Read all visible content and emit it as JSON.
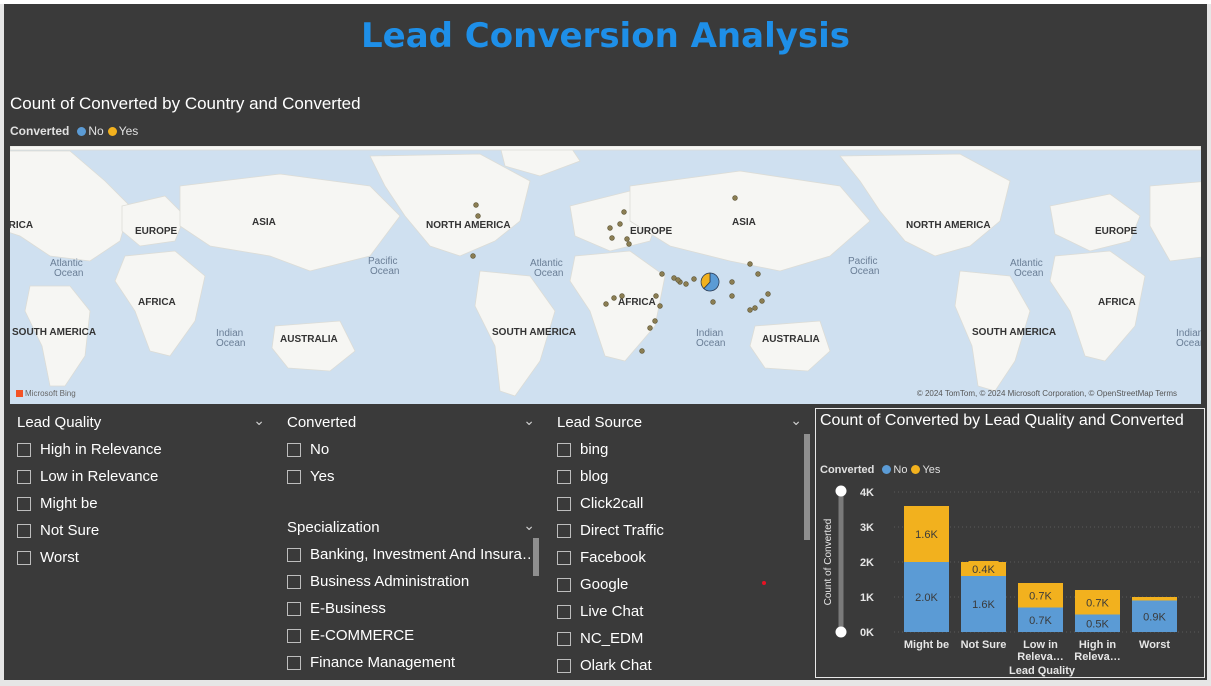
{
  "report_title": "Lead Conversion Analysis",
  "map_visual": {
    "title": "Count of Converted by Country and Converted",
    "legend_title": "Converted",
    "legend": [
      {
        "label": "No",
        "color": "#5b9bd5"
      },
      {
        "label": "Yes",
        "color": "#f2b11e"
      }
    ],
    "continent_labels": [
      "ERICA",
      "EUROPE",
      "ASIA",
      "AFRICA",
      "SOUTH AMERICA",
      "AUSTRALIA",
      "NORTH AMERICA",
      "EUROPE",
      "ASIA",
      "AFRICA",
      "SOUTH AMERICA",
      "AUSTRALIA",
      "NORTH AMERICA",
      "EUROPE",
      "AFRICA",
      "SOUTH AMERICA"
    ],
    "ocean_labels": [
      "Atlantic",
      "Ocean",
      "Pacific",
      "Ocean",
      "Indian",
      "Ocean",
      "Atlantic",
      "Ocean",
      "Indian",
      "Ocean",
      "Pacific",
      "Ocean",
      "Atlantic",
      "Ocean",
      "Indian",
      "Ocean"
    ],
    "provider": "Microsoft Bing",
    "copyright": "© 2024 TomTom, © 2024 Microsoft Corporation, © OpenStreetMap  Terms",
    "pie": {
      "no_fraction": 0.62
    }
  },
  "lead_quality_slicer": {
    "header": "Lead Quality",
    "items": [
      "High in Relevance",
      "Low in Relevance",
      "Might be",
      "Not Sure",
      "Worst"
    ]
  },
  "converted_slicer": {
    "header": "Converted",
    "items": [
      "No",
      "Yes"
    ]
  },
  "specialization_slicer": {
    "header": "Specialization",
    "items": [
      "Banking, Investment And Insura…",
      "Business Administration",
      "E-Business",
      "E-COMMERCE",
      "Finance Management"
    ]
  },
  "lead_source_slicer": {
    "header": "Lead Source",
    "items": [
      "bing",
      "blog",
      "Click2call",
      "Direct Traffic",
      "Facebook",
      "Google",
      "Live Chat",
      "NC_EDM",
      "Olark Chat"
    ]
  },
  "chart_data": {
    "type": "bar",
    "stacked": true,
    "title": "Count of Converted by Lead Quality and Converted",
    "legend_title": "Converted",
    "categories": [
      "Might be",
      "Not Sure",
      "Low in Relevance",
      "High in Relevance",
      "Worst"
    ],
    "category_labels": [
      [
        "Might be"
      ],
      [
        "Not Sure"
      ],
      [
        "Low in",
        "Releva…"
      ],
      [
        "High in",
        "Releva…"
      ],
      [
        "Worst"
      ]
    ],
    "series": [
      {
        "name": "No",
        "color": "#5b9bd5",
        "values": [
          2000,
          1600,
          700,
          500,
          900
        ],
        "labels": [
          "2.0K",
          "1.6K",
          "0.7K",
          "0.5K",
          "0.9K"
        ]
      },
      {
        "name": "Yes",
        "color": "#f2b11e",
        "values": [
          1600,
          400,
          700,
          700,
          100
        ],
        "labels": [
          "1.6K",
          "0.4K",
          "0.7K",
          "0.7K",
          ""
        ]
      }
    ],
    "ylim": [
      0,
      4000
    ],
    "yticks": [
      0,
      1000,
      2000,
      3000,
      4000
    ],
    "ytick_labels": [
      "0K",
      "1K",
      "2K",
      "3K",
      "4K"
    ],
    "xlabel": "Lead Quality",
    "ylabel": "Count of Converted",
    "grid": true,
    "legend_position": "top-left"
  }
}
